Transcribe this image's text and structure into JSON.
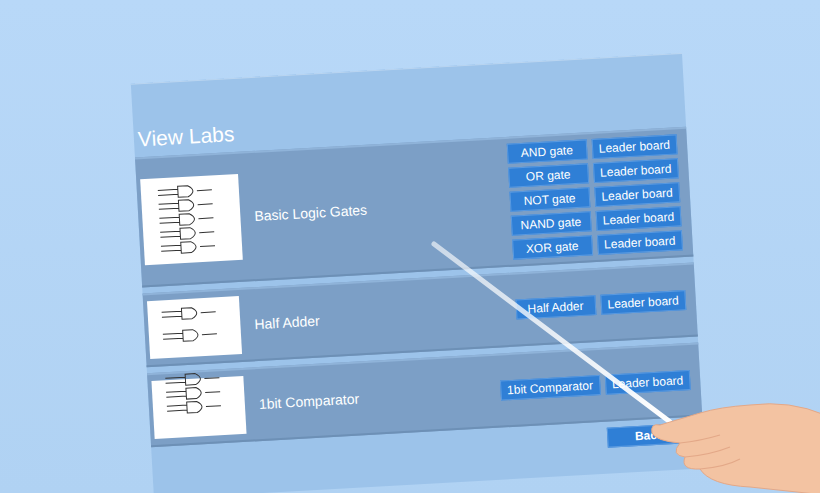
{
  "title": "View Labs",
  "labs": [
    {
      "name": "Basic Logic Gates",
      "experiments": [
        {
          "label": "AND gate",
          "leaderboard": "Leader board"
        },
        {
          "label": "OR gate",
          "leaderboard": "Leader board"
        },
        {
          "label": "NOT gate",
          "leaderboard": "Leader board"
        },
        {
          "label": "NAND gate",
          "leaderboard": "Leader board"
        },
        {
          "label": "XOR gate",
          "leaderboard": "Leader board"
        }
      ]
    },
    {
      "name": "Half Adder",
      "experiments": [
        {
          "label": "Half Adder",
          "leaderboard": "Leader board"
        }
      ]
    },
    {
      "name": "1bit Comparator",
      "experiments": [
        {
          "label": "1bit Comparator",
          "leaderboard": "Leader board"
        }
      ]
    }
  ],
  "back": "Back"
}
